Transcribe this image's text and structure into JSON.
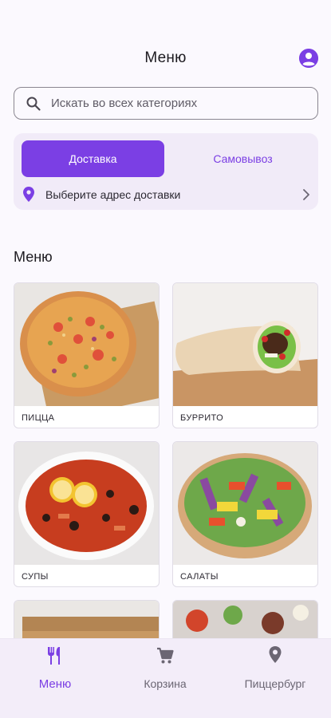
{
  "header": {
    "title": "Меню",
    "profile_icon": "account-circle-icon"
  },
  "search": {
    "placeholder": "Искать во всех категориях",
    "icon": "search-icon"
  },
  "delivery": {
    "tabs": [
      {
        "label": "Доставка",
        "selected": true
      },
      {
        "label": "Самовывоз",
        "selected": false
      }
    ],
    "address_prompt": "Выберите адрес доставки",
    "address_icon": "location-pin-icon",
    "chevron_icon": "chevron-right-icon"
  },
  "menu": {
    "title": "Меню",
    "categories": [
      {
        "label": "ПИЦЦА"
      },
      {
        "label": "БУРРИТО"
      },
      {
        "label": "СУПЫ"
      },
      {
        "label": "САЛАТЫ"
      },
      {
        "label": ""
      },
      {
        "label": ""
      }
    ]
  },
  "bottom_nav": {
    "items": [
      {
        "label": "Меню",
        "icon": "fork-knife-icon",
        "active": true
      },
      {
        "label": "Корзина",
        "icon": "cart-icon",
        "active": false
      },
      {
        "label": "Пиццербург",
        "icon": "location-pin-icon",
        "active": false
      }
    ]
  },
  "colors": {
    "accent": "#7b3fe4",
    "background": "#fbf9fe",
    "card_tint": "#f1ebf8",
    "nav_background": "#f3edf9",
    "inactive_text": "#6b6673"
  }
}
